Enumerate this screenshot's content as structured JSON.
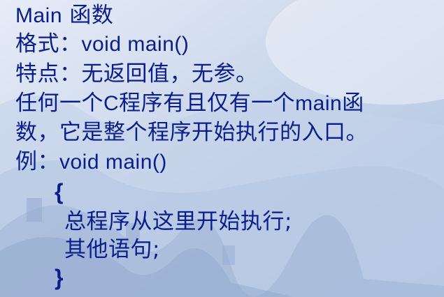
{
  "slide": {
    "lines": {
      "title_latin": "Main",
      "title_cjk": "函数",
      "format_label": "格式：",
      "format_code": "void main()",
      "feature": "特点：无返回值，无参。",
      "desc1_a": "任何一个",
      "desc1_c": "C",
      "desc1_b": "程序有且仅有一个",
      "desc1_main": "main",
      "desc1_d": "函",
      "desc2": "数，它是整个程序开始执行的入口。",
      "example_label": "例：",
      "example_code": "void main()",
      "open_brace": "{",
      "body1": "总程序从这里开始执行;",
      "body2": "其他语句;",
      "close_brace": "}"
    }
  },
  "colors": {
    "text": "#0b1d8a",
    "background": "#cfdbee"
  }
}
